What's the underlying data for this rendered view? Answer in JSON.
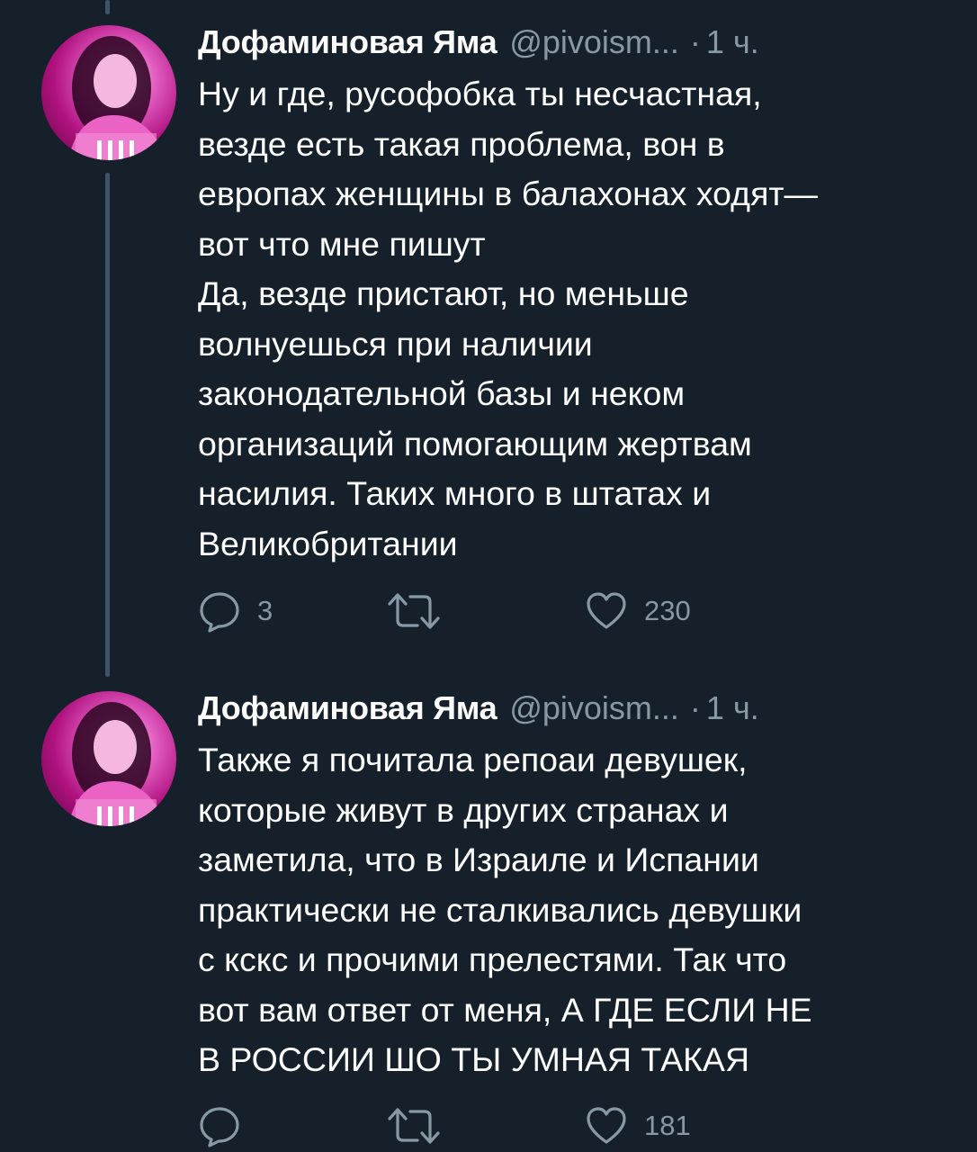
{
  "colors": {
    "background": "#15202b",
    "text": "#ffffff",
    "secondary": "#8899a6",
    "thread_line": "#3d5466"
  },
  "tweets": [
    {
      "author": {
        "name": "Дофаминовая Яма",
        "handle": "@pivoism...",
        "separator": "·",
        "time": "1 ч."
      },
      "text_lines": [
        "Ну и где, русофобка ты несчастная,",
        "везде есть такая проблема, вон в",
        "европах женщины в балахонах ходят—",
        "вот что мне пишут",
        "Да, везде пристают, но меньше",
        "волнуешься при наличии",
        "законодательной базы и неком",
        "организаций помогающим жертвам",
        "насилия. Таких много в штатах и",
        "Великобритании"
      ],
      "actions": {
        "replies": "3",
        "retweets": "",
        "likes": "230"
      }
    },
    {
      "author": {
        "name": "Дофаминовая Яма",
        "handle": "@pivoism...",
        "separator": "·",
        "time": "1 ч."
      },
      "text_lines": [
        "Также я почитала репоаи девушек,",
        "которые живут в других странах и",
        "заметила, что в Израиле и Испании",
        "практически не сталкивались девушки",
        "с кскс и прочими прелестями. Так что",
        "вот вам ответ от меня, А ГДЕ ЕСЛИ НЕ",
        "В РОССИИ ШО ТЫ УМНАЯ ТАКАЯ"
      ],
      "actions": {
        "replies": "",
        "retweets": "",
        "likes": "181"
      }
    }
  ],
  "icons": [
    "reply-icon",
    "retweet-icon",
    "like-icon"
  ]
}
